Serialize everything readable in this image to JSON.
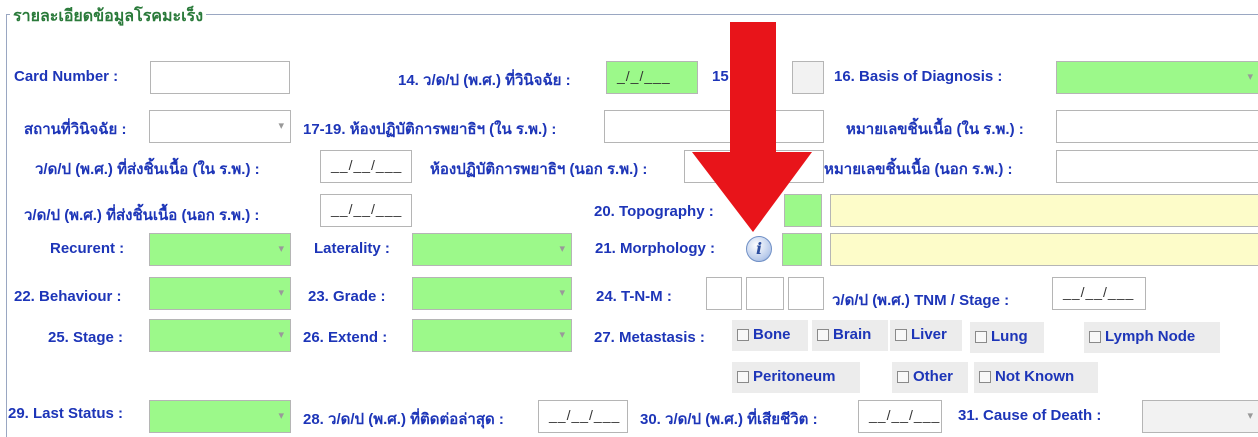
{
  "section_title": "รายละเอียดข้อมูลโรคมะเร็ง",
  "date_mask": "__/__/___",
  "labels": {
    "card_number": "Card Number :",
    "diag_date": "14. ว/ด/ป (พ.ศ.) ที่วินิจฉัย :",
    "diag_date_value": "_/_/___",
    "f15": "15",
    "basis_of_diagnosis": "16. Basis of Diagnosis :",
    "diag_place": "สถานที่วินิจฉัย :",
    "lab_in": "17-19. ห้องปฏิบัติการพยาธิฯ (ใน ร.พ.) :",
    "specimen_no_in": "หมายเลขชิ้นเนื้อ (ใน ร.พ.) :",
    "send_date_in": "ว/ด/ป (พ.ศ.) ที่ส่งชิ้นเนื้อ (ใน ร.พ.) :",
    "lab_out": "ห้องปฏิบัติการพยาธิฯ (นอก ร.พ.) :",
    "specimen_no_out": "หมายเลขชิ้นเนื้อ (นอก ร.พ.) :",
    "send_date_out": "ว/ด/ป (พ.ศ.) ที่ส่งชิ้นเนื้อ (นอก ร.พ.) :",
    "topography": "20. Topography :",
    "recurrent": "Recurent :",
    "laterality": "Laterality :",
    "morphology": "21. Morphology :",
    "behaviour": "22. Behaviour :",
    "grade": "23. Grade :",
    "tnm": "24. T-N-M :",
    "tnm_stage_date": "ว/ด/ป (พ.ศ.) TNM / Stage :",
    "stage": "25. Stage :",
    "extend": "26. Extend :",
    "metastasis": "27. Metastasis :",
    "last_status": "29. Last Status :",
    "last_contact_date": "28. ว/ด/ป (พ.ศ.) ที่ติดต่อล่าสุด :",
    "death_date": "30. ว/ด/ป (พ.ศ.) ที่เสียชีวิต :",
    "cause_of_death": "31. Cause of Death :"
  },
  "metastasis_options": [
    "Bone",
    "Brain",
    "Liver",
    "Lung",
    "Lymph Node",
    "Peritoneum",
    "Other",
    "Not Known"
  ],
  "colors": {
    "label": "#1d35b8",
    "title": "#2a7a3a",
    "required": "#9cf98a",
    "highlight": "#fdfcc9",
    "arrow": "#e8141a"
  },
  "icons": {
    "info": "info-icon",
    "arrow": "red-down-arrow"
  }
}
